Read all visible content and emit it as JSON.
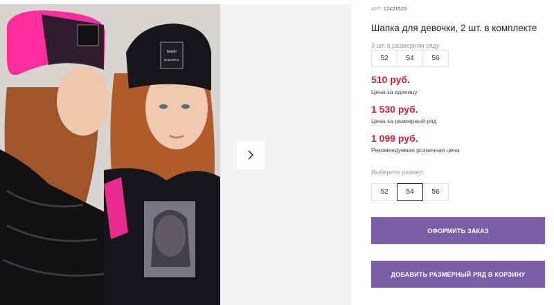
{
  "product": {
    "art_label": "АРТ.",
    "art_number": "12421520",
    "title": "Шапка для девочки, 2 шт. в комплекте"
  },
  "size_set": {
    "label": "3 шт. в размерном ряду",
    "sizes": [
      "52",
      "54",
      "56"
    ]
  },
  "prices": [
    {
      "value": "510 руб.",
      "note": "Цена за единицу"
    },
    {
      "value": "1 530 руб.",
      "note": "Цена за размерный ряд"
    },
    {
      "value": "1 099 руб.",
      "note": "Рекомендуемая розничная цена"
    }
  ],
  "size_picker": {
    "label": "Выберите размер:",
    "sizes": [
      "52",
      "54",
      "56"
    ],
    "selected": "54"
  },
  "buttons": {
    "order": "ОФОРМИТЬ ЗАКАЗ",
    "add_set": "ДОБАВИТЬ РАЗМЕРНЫЙ РЯД В КОРЗИНУ"
  },
  "photo_brand": "bando",
  "colors": {
    "price": "#d0213a",
    "button": "#7b5fa6",
    "hat_pink": "#ff2d9b",
    "hat_black": "#15151a"
  },
  "icons": {
    "next": "chevron-right-icon"
  }
}
